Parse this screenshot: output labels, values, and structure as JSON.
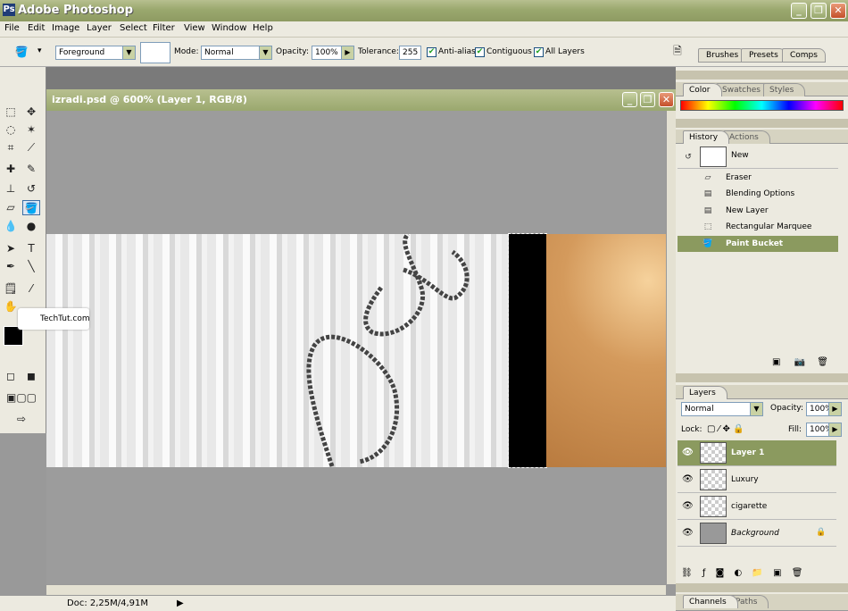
{
  "app": {
    "title": "Adobe Photoshop"
  },
  "menu": [
    "File",
    "Edit",
    "Image",
    "Layer",
    "Select",
    "Filter",
    "View",
    "Window",
    "Help"
  ],
  "options": {
    "fill_source": "Foreground",
    "mode_label": "Mode:",
    "mode_value": "Normal",
    "opacity_label": "Opacity:",
    "opacity_value": "100%",
    "tolerance_label": "Tolerance:",
    "tolerance_value": "255",
    "antialias": "Anti-alias",
    "contiguous": "Contiguous",
    "all_layers": "All Layers",
    "well_tabs": [
      "Brushes",
      "Presets",
      "Comps"
    ]
  },
  "document": {
    "title": "izradi.psd @ 600% (Layer 1, RGB/8)",
    "status": "Doc: 2,25M/4,91M"
  },
  "watermark": "TechTut.com",
  "color_panel": {
    "tabs": [
      "Color",
      "Swatches",
      "Styles"
    ]
  },
  "history_panel": {
    "tabs": [
      "History",
      "Actions"
    ],
    "snapshot": "New",
    "items": [
      "Eraser",
      "Blending Options",
      "New Layer",
      "Rectangular Marquee",
      "Paint Bucket"
    ]
  },
  "layers_panel": {
    "tab": "Layers",
    "blend_mode": "Normal",
    "opacity_label": "Opacity:",
    "opacity_value": "100%",
    "lock_label": "Lock:",
    "fill_label": "Fill:",
    "fill_value": "100%",
    "layers": [
      "Layer 1",
      "Luxury",
      "cigarette",
      "Background"
    ]
  },
  "channels_panel": {
    "tabs": [
      "Channels",
      "Paths"
    ]
  },
  "colors": {
    "title_bar": "#9aa86e",
    "selected_row": "#8b9a5f",
    "panel_bg": "#eceae0"
  }
}
